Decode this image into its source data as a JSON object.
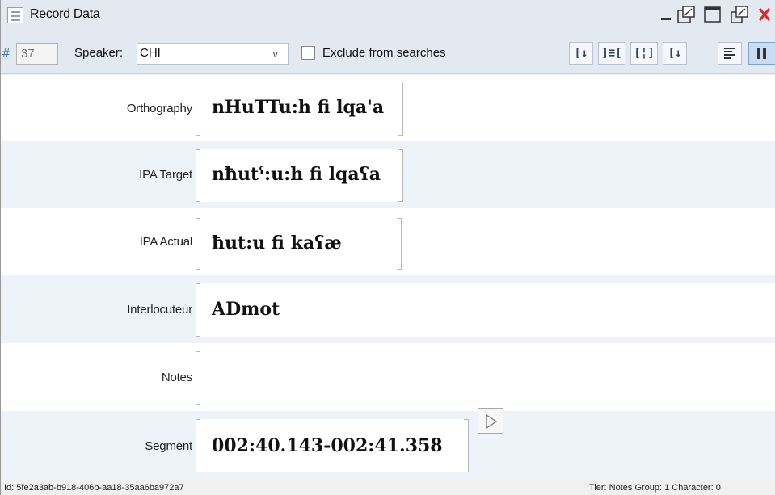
{
  "window": {
    "title": "Record Data"
  },
  "toolbar": {
    "hash": "#",
    "record_number": "37",
    "speaker_label": "Speaker:",
    "speaker_value": "CHI",
    "exclude_label": "Exclude from searches",
    "exclude_checked": false
  },
  "tiers": [
    {
      "label": "Orthography",
      "value": "nHuTTu:h fi lqa'a"
    },
    {
      "label": "IPA Target",
      "value": "nħutˤ:u:h fi lqaʕa"
    },
    {
      "label": "IPA Actual",
      "value": "ħut:u fi kaʕæ"
    },
    {
      "label": "Interlocuteur",
      "value": "ADmot"
    },
    {
      "label": "Notes",
      "value": ""
    },
    {
      "label": "Segment",
      "value": "002:40.143-002:41.358"
    }
  ],
  "status": {
    "id_text": "Id: 5fe2a3ab-b918-406b-aa18-35aa6ba972a7",
    "right_text": "Tier: Notes Group: 1  Character: 0"
  },
  "colors": {
    "close": "#d9262c",
    "accent": "#3a6fb0",
    "alt_row": "#eef3f9"
  }
}
